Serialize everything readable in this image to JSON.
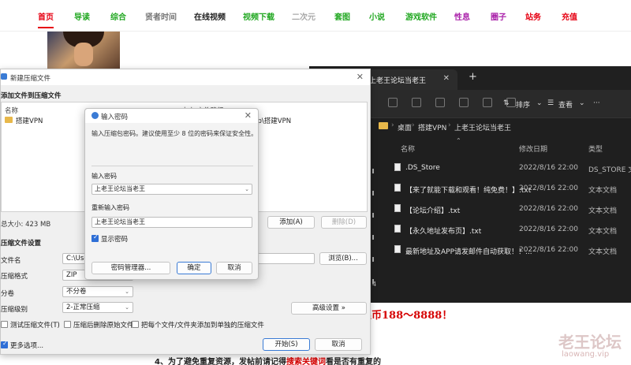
{
  "site": {
    "nav": [
      {
        "label": "首页",
        "color": "#e60012"
      },
      {
        "label": "导读",
        "color": "#22a822"
      },
      {
        "label": "综合",
        "color": "#22a822"
      },
      {
        "label": "贤者时间",
        "color": "#777777"
      },
      {
        "label": "在线视频",
        "color": "#222222"
      },
      {
        "label": "视频下载",
        "color": "#22a822"
      },
      {
        "label": "二次元",
        "color": "#aaaaaa"
      },
      {
        "label": "套图",
        "color": "#22a822"
      },
      {
        "label": "小说",
        "color": "#22a822"
      },
      {
        "label": "游戏软件",
        "color": "#22a822"
      },
      {
        "label": "性息",
        "color": "#aa22aa"
      },
      {
        "label": "圈子",
        "color": "#aa22aa"
      },
      {
        "label": "站务",
        "color": "#e60012"
      },
      {
        "label": "充值",
        "color": "#e60012"
      }
    ],
    "promo": "狼币188～8888！",
    "bottom_prefix": "4、为了避免重复资源，发帖前请记得",
    "bottom_link": "搜索关键词",
    "bottom_suffix": "看是否有重复的",
    "watermark": "老王论坛",
    "watermark_url": "laowang.vip"
  },
  "explorer": {
    "tab_title": "上老王论坛当老王",
    "toolbar": {
      "sort_label": "排序",
      "view_label": "查看",
      "more_label": "···"
    },
    "breadcrumb": [
      "桌面",
      "搭建VPN",
      "上老王论坛当老王"
    ],
    "columns": {
      "name": "名称",
      "date": "修改日期",
      "type": "类型"
    },
    "files": [
      {
        "name": ".DS_Store",
        "date": "2022/8/16 22:00",
        "type": "DS_STORE 文件"
      },
      {
        "name": "【来了就能下载和观看！纯免费！】.txt",
        "date": "2022/8/16 22:00",
        "type": "文本文档"
      },
      {
        "name": "【论坛介绍】.txt",
        "date": "2022/8/16 22:00",
        "type": "文本文档"
      },
      {
        "name": "【永久地址发布页】.txt",
        "date": "2022/8/16 22:00",
        "type": "文本文档"
      },
      {
        "name": "最新地址及APP请发邮件自动获取！！...",
        "date": "2022/8/16 22:00",
        "type": "文本文档"
      }
    ],
    "side_count": "4"
  },
  "archive": {
    "title": "新建压缩文件",
    "section_add": "添加文件到压缩文件",
    "list_header_name": "名称",
    "list_header_path": "大小  文件路径",
    "row_name": "搭建VPN",
    "row_path": "top\\搭建VPN",
    "total_size": "总大小: 423 MB",
    "add_button": "添加(A)",
    "delete_button": "删除(D)",
    "section_settings": "压缩文件设置",
    "file_name_label": "文件名",
    "file_name_value": "C:\\Users",
    "browse_button": "浏览(B)...",
    "format_label": "压缩格式",
    "format_value": "ZIP",
    "split_label": "分卷",
    "split_value": "不分卷",
    "level_label": "压缩级别",
    "level_value": "2-正常压缩",
    "advanced_button": "高级设置 »",
    "test_label": "测试压缩文件(T)",
    "delete_after_label": "压缩后删除原始文件",
    "each_separate_label": "把每个文件/文件夹添加到单独的压缩文件",
    "more_options": "更多选项...",
    "start_button": "开始(S)",
    "cancel_button": "取消"
  },
  "password_dialog": {
    "title": "输入密码",
    "description": "输入压缩包密码。建议使用至少 8 位的密码来保证安全性。",
    "enter_label": "输入密码",
    "enter_value": "上老王论坛当老王",
    "reenter_label": "重新输入密码",
    "reenter_value": "上老王论坛当老王",
    "show_password_label": "显示密码",
    "manager_button": "密码管理器...",
    "ok_button": "确定",
    "cancel_button": "取消"
  }
}
